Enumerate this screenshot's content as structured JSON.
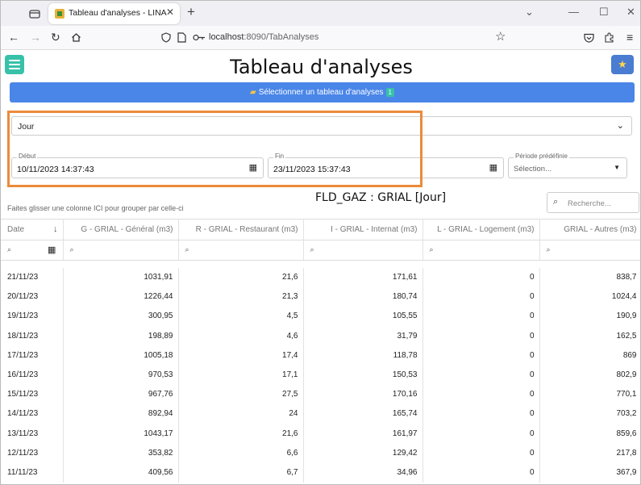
{
  "browser": {
    "tab_title": "Tableau d'analyses - LINA",
    "url_host": "localhost",
    "url_path": ":8090/TabAnalyses"
  },
  "app": {
    "page_title": "Tableau d'analyses",
    "select_button_label": "Sélectionner un tableau d'analyses",
    "select_badge": "1",
    "period_value": "Jour",
    "start_label": "Début",
    "start_value": "10/11/2023 14:37:43",
    "end_label": "Fin",
    "end_value": "23/11/2023 15:37:43",
    "predefined_label": "Période prédéfinie",
    "predefined_value": "Sélection...",
    "group_hint": "Faites glisser une colonne ICI pour grouper par celle-ci",
    "grid_title": "FLD_GAZ : GRIAL [Jour]",
    "search_placeholder": "Recherche..."
  },
  "colors": {
    "accent_teal": "#37c1a9",
    "primary_blue": "#4a86e8",
    "highlight_orange": "#ec8a3a"
  },
  "grid": {
    "columns": [
      "Date",
      "G - GRIAL - Général (m3)",
      "R - GRIAL - Restaurant (m3)",
      "I - GRIAL - Internat (m3)",
      "L - GRIAL - Logement (m3)",
      "GRIAL - Autres (m3)"
    ],
    "rows": [
      [
        "21/11/23",
        "1031,91",
        "21,6",
        "171,61",
        "0",
        "838,7"
      ],
      [
        "20/11/23",
        "1226,44",
        "21,3",
        "180,74",
        "0",
        "1024,4"
      ],
      [
        "19/11/23",
        "300,95",
        "4,5",
        "105,55",
        "0",
        "190,9"
      ],
      [
        "18/11/23",
        "198,89",
        "4,6",
        "31,79",
        "0",
        "162,5"
      ],
      [
        "17/11/23",
        "1005,18",
        "17,4",
        "118,78",
        "0",
        "869"
      ],
      [
        "16/11/23",
        "970,53",
        "17,1",
        "150,53",
        "0",
        "802,9"
      ],
      [
        "15/11/23",
        "967,76",
        "27,5",
        "170,16",
        "0",
        "770,1"
      ],
      [
        "14/11/23",
        "892,94",
        "24",
        "165,74",
        "0",
        "703,2"
      ],
      [
        "13/11/23",
        "1043,17",
        "21,6",
        "161,97",
        "0",
        "859,6"
      ],
      [
        "12/11/23",
        "353,82",
        "6,6",
        "129,42",
        "0",
        "217,8"
      ],
      [
        "11/11/23",
        "409,56",
        "6,7",
        "34,96",
        "0",
        "367,9"
      ]
    ]
  }
}
